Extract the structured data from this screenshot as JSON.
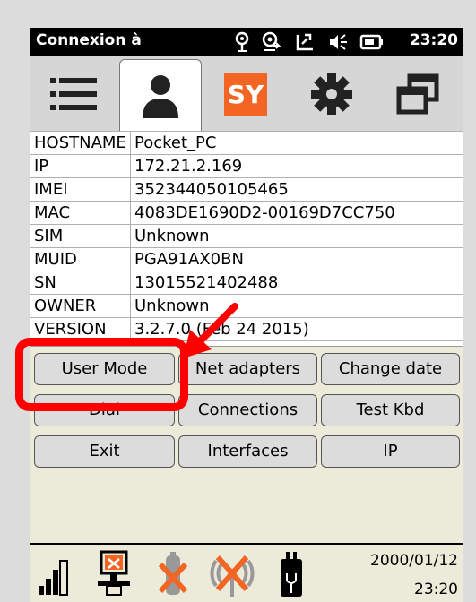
{
  "status_bar": {
    "title": "Connexion à",
    "time": "23:20",
    "icons": [
      "location-icon",
      "sync-icon",
      "wifi-signal-icon",
      "volume-icon",
      "battery-icon"
    ]
  },
  "tabs": [
    {
      "name": "list-icon",
      "active": false
    },
    {
      "name": "user-icon",
      "active": true
    },
    {
      "name": "sy-logo",
      "label": "SY",
      "active": false
    },
    {
      "name": "gear-icon",
      "active": false
    },
    {
      "name": "windows-icon",
      "active": false
    }
  ],
  "info": {
    "rows": [
      {
        "key": "HOSTNAME",
        "value": "Pocket_PC"
      },
      {
        "key": "IP",
        "value": "172.21.2.169"
      },
      {
        "key": "IMEI",
        "value": "352344050105465"
      },
      {
        "key": "MAC",
        "value": "4083DE1690D2-00169D7CC750"
      },
      {
        "key": "SIM",
        "value": "Unknown"
      },
      {
        "key": "MUID",
        "value": "PGA91AX0BN"
      },
      {
        "key": "SN",
        "value": "13015521402488"
      },
      {
        "key": "OWNER",
        "value": "Unknown"
      },
      {
        "key": "VERSION",
        "value": "3.2.7.0 (Feb 24 2015)"
      }
    ]
  },
  "buttons": {
    "user_mode": "User Mode",
    "net_adapters": "Net adapters",
    "change_date": "Change date",
    "dial": "Dial",
    "connections": "Connections",
    "test_kbd": "Test Kbd",
    "exit": "Exit",
    "interfaces": "Interfaces",
    "ip": "IP"
  },
  "bottom_bar": {
    "date": "2000/01/12",
    "time": "23:20"
  },
  "colors": {
    "accent_orange": "#f26522",
    "annotation_red": "#ff0000",
    "button_area_bg": "#ecebd9"
  }
}
